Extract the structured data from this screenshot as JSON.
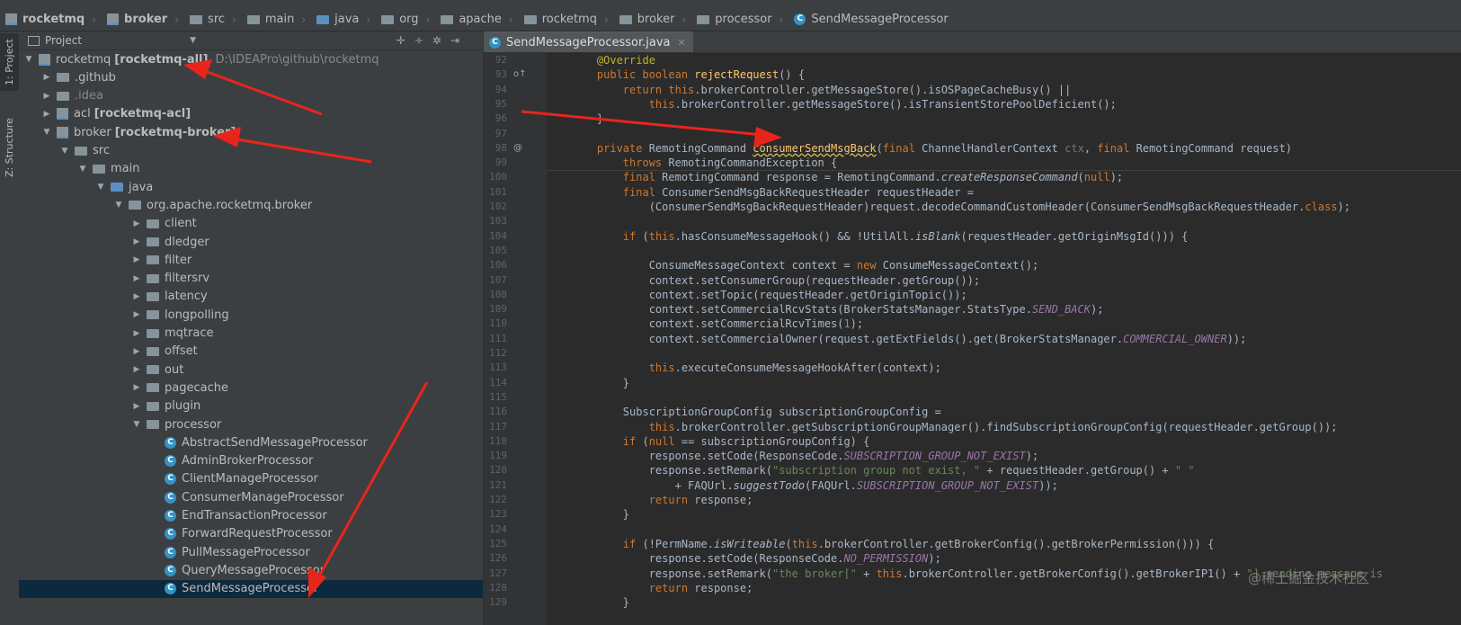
{
  "breadcrumb": [
    "rocketmq",
    "broker",
    "src",
    "main",
    "java",
    "org",
    "apache",
    "rocketmq",
    "broker",
    "processor",
    "SendMessageProcessor"
  ],
  "left_toolwindow": {
    "project_tab": "1: Project",
    "structure_tab": "Z: Structure"
  },
  "project_panel": {
    "title": "Project",
    "tree": [
      {
        "indent": 0,
        "arrow": "down",
        "icon": "module",
        "label": "rocketmq",
        "bold": "[rocketmq-all]",
        "path": "D:\\IDEAPro\\github\\rocketmq"
      },
      {
        "indent": 1,
        "arrow": "right",
        "icon": "folder",
        "label": ".github"
      },
      {
        "indent": 1,
        "arrow": "right",
        "icon": "folder",
        "label": ".idea",
        "dim": true
      },
      {
        "indent": 1,
        "arrow": "right",
        "icon": "module",
        "label": "acl",
        "bold": "[rocketmq-acl]"
      },
      {
        "indent": 1,
        "arrow": "down",
        "icon": "module",
        "label": "broker",
        "bold": "[rocketmq-broker]"
      },
      {
        "indent": 2,
        "arrow": "down",
        "icon": "folder",
        "label": "src"
      },
      {
        "indent": 3,
        "arrow": "down",
        "icon": "folder",
        "label": "main"
      },
      {
        "indent": 4,
        "arrow": "down",
        "icon": "folder-blue",
        "label": "java"
      },
      {
        "indent": 5,
        "arrow": "down",
        "icon": "folder",
        "label": "org.apache.rocketmq.broker"
      },
      {
        "indent": 6,
        "arrow": "right",
        "icon": "folder",
        "label": "client"
      },
      {
        "indent": 6,
        "arrow": "right",
        "icon": "folder",
        "label": "dledger"
      },
      {
        "indent": 6,
        "arrow": "right",
        "icon": "folder",
        "label": "filter"
      },
      {
        "indent": 6,
        "arrow": "right",
        "icon": "folder",
        "label": "filtersrv"
      },
      {
        "indent": 6,
        "arrow": "right",
        "icon": "folder",
        "label": "latency"
      },
      {
        "indent": 6,
        "arrow": "right",
        "icon": "folder",
        "label": "longpolling"
      },
      {
        "indent": 6,
        "arrow": "right",
        "icon": "folder",
        "label": "mqtrace"
      },
      {
        "indent": 6,
        "arrow": "right",
        "icon": "folder",
        "label": "offset"
      },
      {
        "indent": 6,
        "arrow": "right",
        "icon": "folder",
        "label": "out"
      },
      {
        "indent": 6,
        "arrow": "right",
        "icon": "folder",
        "label": "pagecache"
      },
      {
        "indent": 6,
        "arrow": "right",
        "icon": "folder",
        "label": "plugin"
      },
      {
        "indent": 6,
        "arrow": "down",
        "icon": "folder",
        "label": "processor"
      },
      {
        "indent": 7,
        "arrow": "none",
        "icon": "class",
        "label": "AbstractSendMessageProcessor"
      },
      {
        "indent": 7,
        "arrow": "none",
        "icon": "class",
        "label": "AdminBrokerProcessor"
      },
      {
        "indent": 7,
        "arrow": "none",
        "icon": "class",
        "label": "ClientManageProcessor"
      },
      {
        "indent": 7,
        "arrow": "none",
        "icon": "class",
        "label": "ConsumerManageProcessor"
      },
      {
        "indent": 7,
        "arrow": "none",
        "icon": "class",
        "label": "EndTransactionProcessor"
      },
      {
        "indent": 7,
        "arrow": "none",
        "icon": "class",
        "label": "ForwardRequestProcessor"
      },
      {
        "indent": 7,
        "arrow": "none",
        "icon": "class",
        "label": "PullMessageProcessor"
      },
      {
        "indent": 7,
        "arrow": "none",
        "icon": "class",
        "label": "QueryMessageProcessor"
      },
      {
        "indent": 7,
        "arrow": "none",
        "icon": "class",
        "label": "SendMessageProcessor",
        "selected": true
      }
    ]
  },
  "editor": {
    "tab_label": "SendMessageProcessor.java",
    "lines": [
      {
        "n": "92",
        "segs": [
          [
            "ann",
            "    @Override"
          ]
        ]
      },
      {
        "n": "93",
        "mk": "o↑",
        "segs": [
          [
            "kw",
            "    public boolean "
          ],
          [
            "fn",
            "rejectRequest"
          ],
          [
            "",
            "() {"
          ]
        ]
      },
      {
        "n": "94",
        "segs": [
          [
            "kw",
            "        return this"
          ],
          [
            "",
            ".brokerController.getMessageStore().isOSPageCacheBusy() ||"
          ]
        ]
      },
      {
        "n": "95",
        "segs": [
          [
            "kw",
            "            this"
          ],
          [
            "",
            ".brokerController.getMessageStore().isTransientStorePoolDeficient();"
          ]
        ]
      },
      {
        "n": "96",
        "segs": [
          [
            "",
            "    }"
          ]
        ]
      },
      {
        "n": "97",
        "segs": []
      },
      {
        "n": "98",
        "mk": "@",
        "segs": [
          [
            "kw",
            "    private "
          ],
          [
            "",
            "RemotingCommand "
          ],
          [
            "fn sq",
            "consumerSendMsgBack"
          ],
          [
            "",
            "("
          ],
          [
            "kw",
            "final "
          ],
          [
            "",
            "ChannelHandlerContext "
          ],
          [
            "pm",
            "ctx"
          ],
          [
            "",
            ", "
          ],
          [
            "kw",
            "final "
          ],
          [
            "",
            "RemotingCommand request)"
          ]
        ]
      },
      {
        "n": "99",
        "segs": [
          [
            "kw",
            "        throws "
          ],
          [
            "",
            "RemotingCommandException {"
          ]
        ]
      },
      {
        "n": "100",
        "segs": [
          [
            "kw",
            "        final "
          ],
          [
            "",
            "RemotingCommand response = RemotingCommand."
          ],
          [
            "it",
            "createResponseCommand"
          ],
          [
            "",
            "("
          ],
          [
            "kw",
            "null"
          ],
          [
            "",
            ");"
          ]
        ]
      },
      {
        "n": "101",
        "segs": [
          [
            "kw",
            "        final "
          ],
          [
            "",
            "ConsumerSendMsgBackRequestHeader requestHeader ="
          ]
        ]
      },
      {
        "n": "102",
        "segs": [
          [
            "",
            "            (ConsumerSendMsgBackRequestHeader)request.decodeCommandCustomHeader(ConsumerSendMsgBackRequestHeader."
          ],
          [
            "kw",
            "class"
          ],
          [
            "",
            ");"
          ]
        ]
      },
      {
        "n": "103",
        "segs": []
      },
      {
        "n": "104",
        "segs": [
          [
            "kw",
            "        if "
          ],
          [
            "",
            "("
          ],
          [
            "kw",
            "this"
          ],
          [
            "",
            ".hasConsumeMessageHook() && !UtilAll."
          ],
          [
            "it",
            "isBlank"
          ],
          [
            "",
            "(requestHeader.getOriginMsgId())) {"
          ]
        ]
      },
      {
        "n": "105",
        "segs": []
      },
      {
        "n": "106",
        "segs": [
          [
            "",
            "            ConsumeMessageContext context = "
          ],
          [
            "kw",
            "new "
          ],
          [
            "",
            "ConsumeMessageContext();"
          ]
        ]
      },
      {
        "n": "107",
        "segs": [
          [
            "",
            "            context.setConsumerGroup(requestHeader.getGroup());"
          ]
        ]
      },
      {
        "n": "108",
        "segs": [
          [
            "",
            "            context.setTopic(requestHeader.getOriginTopic());"
          ]
        ]
      },
      {
        "n": "109",
        "segs": [
          [
            "",
            "            context.setCommercialRcvStats(BrokerStatsManager.StatsType."
          ],
          [
            "cst",
            "SEND_BACK"
          ],
          [
            "",
            ");"
          ]
        ]
      },
      {
        "n": "110",
        "segs": [
          [
            "",
            "            context.setCommercialRcvTimes("
          ],
          [
            "nm",
            "1"
          ],
          [
            "",
            ");"
          ]
        ]
      },
      {
        "n": "111",
        "segs": [
          [
            "",
            "            context.setCommercialOwner(request.getExtFields().get(BrokerStatsManager."
          ],
          [
            "cst",
            "COMMERCIAL_OWNER"
          ],
          [
            "",
            "));"
          ]
        ]
      },
      {
        "n": "112",
        "segs": []
      },
      {
        "n": "113",
        "segs": [
          [
            "kw",
            "            this"
          ],
          [
            "",
            ".executeConsumeMessageHookAfter(context);"
          ]
        ]
      },
      {
        "n": "114",
        "segs": [
          [
            "",
            "        }"
          ]
        ]
      },
      {
        "n": "115",
        "segs": []
      },
      {
        "n": "116",
        "segs": [
          [
            "",
            "        SubscriptionGroupConfig subscriptionGroupConfig ="
          ]
        ]
      },
      {
        "n": "117",
        "segs": [
          [
            "kw",
            "            this"
          ],
          [
            "",
            ".brokerController.getSubscriptionGroupManager().findSubscriptionGroupConfig(requestHeader.getGroup());"
          ]
        ]
      },
      {
        "n": "118",
        "segs": [
          [
            "kw",
            "        if "
          ],
          [
            "",
            "("
          ],
          [
            "kw",
            "null "
          ],
          [
            "",
            "== subscriptionGroupConfig) {"
          ]
        ]
      },
      {
        "n": "119",
        "segs": [
          [
            "",
            "            response.setCode(ResponseCode."
          ],
          [
            "cst",
            "SUBSCRIPTION_GROUP_NOT_EXIST"
          ],
          [
            "",
            ");"
          ]
        ]
      },
      {
        "n": "120",
        "segs": [
          [
            "",
            "            response.setRemark("
          ],
          [
            "str",
            "\"subscription group not exist, \" "
          ],
          [
            "",
            "+ requestHeader.getGroup() + "
          ],
          [
            "str",
            "\" \""
          ]
        ]
      },
      {
        "n": "121",
        "segs": [
          [
            "",
            "                + FAQUrl."
          ],
          [
            "it",
            "suggestTodo"
          ],
          [
            "",
            "(FAQUrl."
          ],
          [
            "cst",
            "SUBSCRIPTION_GROUP_NOT_EXIST"
          ],
          [
            "",
            "));"
          ]
        ]
      },
      {
        "n": "122",
        "segs": [
          [
            "kw",
            "            return "
          ],
          [
            "",
            "response;"
          ]
        ]
      },
      {
        "n": "123",
        "segs": [
          [
            "",
            "        }"
          ]
        ]
      },
      {
        "n": "124",
        "segs": []
      },
      {
        "n": "125",
        "segs": [
          [
            "kw",
            "        if "
          ],
          [
            "",
            "(!PermName."
          ],
          [
            "it",
            "isWriteable"
          ],
          [
            "",
            "("
          ],
          [
            "kw",
            "this"
          ],
          [
            "",
            ".brokerController.getBrokerConfig().getBrokerPermission())) {"
          ]
        ]
      },
      {
        "n": "126",
        "segs": [
          [
            "",
            "            response.setCode(ResponseCode."
          ],
          [
            "cst",
            "NO_PERMISSION"
          ],
          [
            "",
            ");"
          ]
        ]
      },
      {
        "n": "127",
        "segs": [
          [
            "",
            "            response.setRemark("
          ],
          [
            "str",
            "\"the broker[\" "
          ],
          [
            "",
            "+ "
          ],
          [
            "kw",
            "this"
          ],
          [
            "",
            ".brokerController.getBrokerConfig().getBrokerIP1() + "
          ],
          [
            "str",
            "\"] sending message is"
          ]
        ]
      },
      {
        "n": "128",
        "segs": [
          [
            "kw",
            "            return "
          ],
          [
            "",
            "response;"
          ]
        ]
      },
      {
        "n": "129",
        "segs": [
          [
            "",
            "        }"
          ]
        ]
      }
    ]
  },
  "watermark": "@稀土掘金技术社区",
  "colors": {
    "annotation_arrow": "#e8251c",
    "selection": "#0d293e",
    "editor_bg": "#2b2b2b",
    "panel_bg": "#3c3f41"
  }
}
